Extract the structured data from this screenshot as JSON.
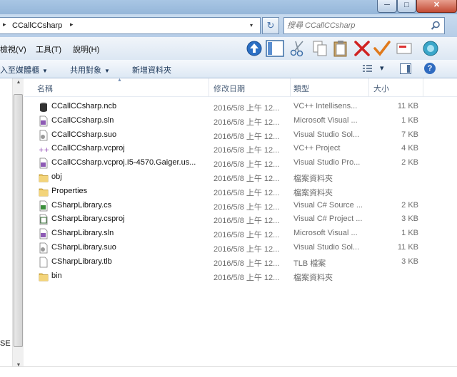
{
  "window": {
    "min_label": "─",
    "max_label": "□",
    "close_label": "✕"
  },
  "address": {
    "leading_arrow": "▸",
    "folder": "CCallCCsharp",
    "trailing_arrow": "▸",
    "dropdown": "▾",
    "refresh_glyph": "↻"
  },
  "search": {
    "placeholder": "搜尋 CCallCCsharp"
  },
  "menu": {
    "items": [
      "檢視(V)",
      "工具(T)",
      "說明(H)"
    ]
  },
  "toolbar": {
    "icons": [
      "up-arrow-icon",
      "preview-pane-icon",
      "cut-icon",
      "copy-icon",
      "paste-icon",
      "delete-icon",
      "properties-check-icon",
      "email-icon",
      "network-icon"
    ]
  },
  "commands": {
    "include_library": "入至媒體櫃",
    "share_with": "共用對象",
    "new_folder": "新增資料夾",
    "views_caret": "▾",
    "help": "?"
  },
  "nav": {
    "cut_text": "SE"
  },
  "columns": {
    "name": "名稱",
    "date": "修改日期",
    "type": "類型",
    "size": "大小"
  },
  "colors": {
    "titlebar": "#a9c6e4",
    "accent": "#1e395b",
    "folder": "#e8c25a"
  },
  "files": [
    {
      "icon": "database-file-icon",
      "name": "CCallCCsharp.ncb",
      "date": "2016/5/8 上午 12...",
      "type": "VC++ Intellisens...",
      "size": "11 KB"
    },
    {
      "icon": "solution-file-icon",
      "name": "CCallCCsharp.sln",
      "date": "2016/5/8 上午 12...",
      "type": "Microsoft Visual ...",
      "size": "1 KB"
    },
    {
      "icon": "suo-file-icon",
      "name": "CCallCCsharp.suo",
      "date": "2016/5/8 上午 12...",
      "type": "Visual Studio Sol...",
      "size": "7 KB"
    },
    {
      "icon": "vcproj-file-icon",
      "name": "CCallCCsharp.vcproj",
      "date": "2016/5/8 上午 12...",
      "type": "VC++ Project",
      "size": "4 KB"
    },
    {
      "icon": "solution-file-icon",
      "name": "CCallCCsharp.vcproj.I5-4570.Gaiger.us...",
      "date": "2016/5/8 上午 12...",
      "type": "Visual Studio Pro...",
      "size": "2 KB"
    },
    {
      "icon": "folder-icon",
      "name": "obj",
      "date": "2016/5/8 上午 12...",
      "type": "檔案資料夾",
      "size": ""
    },
    {
      "icon": "folder-icon",
      "name": "Properties",
      "date": "2016/5/8 上午 12...",
      "type": "檔案資料夾",
      "size": ""
    },
    {
      "icon": "csharp-file-icon",
      "name": "CSharpLibrary.cs",
      "date": "2016/5/8 上午 12...",
      "type": "Visual C# Source ...",
      "size": "2 KB"
    },
    {
      "icon": "csproj-file-icon",
      "name": "CSharpLibrary.csproj",
      "date": "2016/5/8 上午 12...",
      "type": "Visual C# Project ...",
      "size": "3 KB"
    },
    {
      "icon": "solution-file-icon",
      "name": "CSharpLibrary.sln",
      "date": "2016/5/8 上午 12...",
      "type": "Microsoft Visual ...",
      "size": "1 KB"
    },
    {
      "icon": "suo-file-icon",
      "name": "CSharpLibrary.suo",
      "date": "2016/5/8 上午 12...",
      "type": "Visual Studio Sol...",
      "size": "11 KB"
    },
    {
      "icon": "blank-file-icon",
      "name": "CSharpLibrary.tlb",
      "date": "2016/5/8 上午 12...",
      "type": "TLB 檔案",
      "size": "3 KB"
    },
    {
      "icon": "folder-icon",
      "name": "bin",
      "date": "2016/5/8 上午 12...",
      "type": "檔案資料夾",
      "size": ""
    }
  ]
}
